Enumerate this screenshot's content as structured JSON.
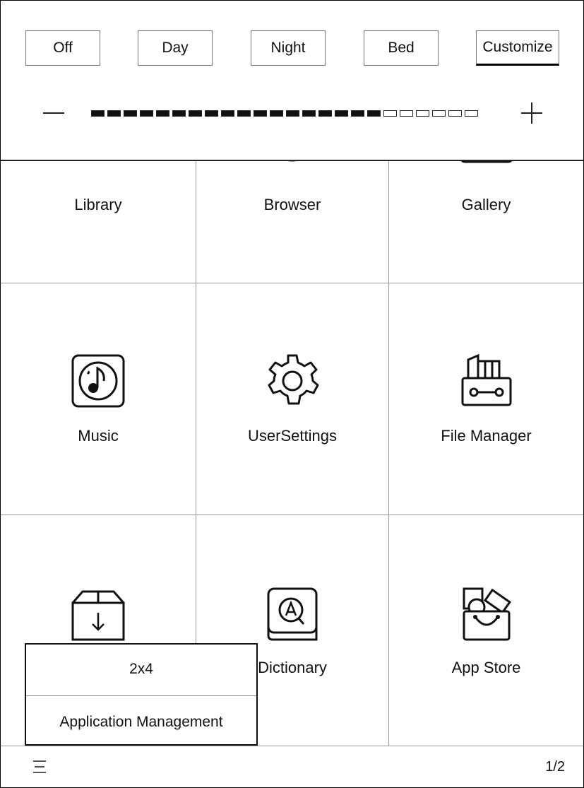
{
  "light": {
    "modes": [
      "Off",
      "Day",
      "Night",
      "Bed",
      "Customize"
    ],
    "selected": "Customize",
    "level": 18,
    "level_max": 24
  },
  "apps": {
    "library": "Library",
    "browser": "Browser",
    "gallery": "Gallery",
    "music": "Music",
    "usersettings": "UserSettings",
    "filemanager": "File Manager",
    "dictionary": "Dictionary",
    "appstore": "App Store"
  },
  "popup": {
    "layout": "2x4",
    "app_management": "Application Management"
  },
  "footer": {
    "page": "1/2"
  },
  "icons": {
    "library": "library-icon",
    "browser": "compass-icon",
    "gallery": "gallery-icon",
    "music": "music-note-icon",
    "settings": "gear-icon",
    "files": "file-manager-icon",
    "install": "download-box-icon",
    "dictionary": "dictionary-icon",
    "store": "app-store-icon",
    "menu": "menu-icon"
  }
}
